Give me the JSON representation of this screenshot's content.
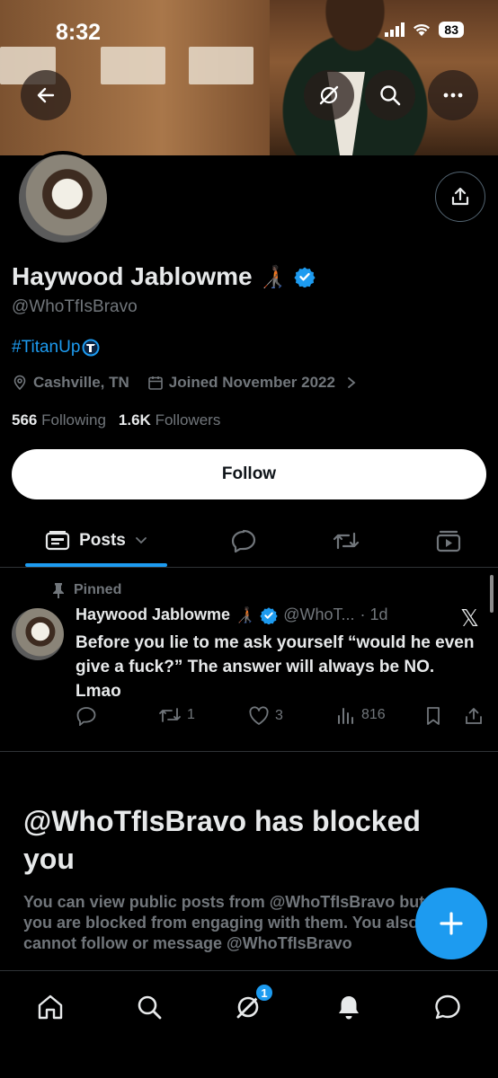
{
  "status_bar": {
    "time": "8:32",
    "battery": "83"
  },
  "header": {
    "icons": [
      "back-arrow-icon",
      "grok-icon",
      "search-icon",
      "more-icon"
    ]
  },
  "profile": {
    "display_name": "Haywood Jablowme",
    "name_emoji": "🧑🏿‍🦯",
    "handle": "@WhoTfIsBravo",
    "bio": "#TitanUp",
    "location": "Cashville, TN",
    "joined": "Joined November 2022",
    "following_count": "566",
    "following_label": "Following",
    "followers_count": "1.6K",
    "followers_label": "Followers",
    "follow_button": "Follow"
  },
  "tabs": {
    "posts_label": "Posts",
    "items": [
      "posts-tab",
      "replies-icon",
      "reposts-icon",
      "media-icon"
    ]
  },
  "pinned_post": {
    "pinned_label": "Pinned",
    "name": "Haywood Jablowme",
    "handle": "@WhoT...",
    "time": "· 1d",
    "text": "Before you lie to me ask yourself “would he even give a fuck?” The answer will always be NO. Lmao",
    "replies": "",
    "reposts": "1",
    "likes": "3",
    "views": "816"
  },
  "blocked": {
    "title": "@WhoTfIsBravo has blocked you",
    "description": "You can view public posts from @WhoTfIsBravo but you are blocked from engaging with them. You also cannot follow or message @WhoTfIsBravo"
  },
  "bottom_nav": {
    "items": [
      "home-icon",
      "search-icon",
      "grok-icon",
      "notifications-icon",
      "messages-icon"
    ],
    "grok_badge": "1"
  },
  "colors": {
    "accent": "#1d9bf0",
    "background": "#000000",
    "muted": "#71767b"
  }
}
